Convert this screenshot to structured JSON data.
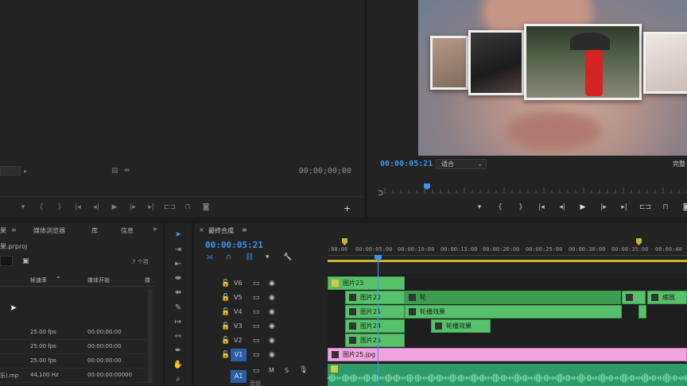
{
  "source_monitor": {
    "timecode": "00;00;00;00"
  },
  "program_monitor": {
    "timecode": "00:00:05:21",
    "fit": "适合",
    "right_label": "完整"
  },
  "project_panel": {
    "tabs": [
      "果",
      "媒体浏览器",
      "库",
      "信息"
    ],
    "project_file": "果.prproj",
    "item_count": "7 个项",
    "columns": [
      "帧速率",
      "媒体开始",
      "媒"
    ],
    "rows": [
      {
        "name": "",
        "fps": "25.00 fps",
        "start": "00:00:00:00"
      },
      {
        "name": "",
        "fps": "25.00 fps",
        "start": "00:00:00:00"
      },
      {
        "name": "",
        "fps": "25.00 fps",
        "start": "00:00:00:00"
      },
      {
        "name": "",
        "fps": "25.00 fps",
        "start": "00:00:00:00"
      },
      {
        "name": "乐).mp",
        "fps": "44,100 Hz",
        "start": "00:00:00:00000"
      }
    ]
  },
  "timeline": {
    "sequence_name": "最终合成",
    "timecode": "00:00:05:21",
    "ruler_labels": [
      ":00:00",
      "00:00:05:00",
      "00:00:10:00",
      "00:00:15:00",
      "00:00:20:00",
      "00:00:25:00",
      "00:00:30:00",
      "00:00:35:00",
      "00:00:40"
    ],
    "tracks": [
      {
        "label": "V6"
      },
      {
        "label": "V5"
      },
      {
        "label": "V4"
      },
      {
        "label": "V3"
      },
      {
        "label": "V2"
      },
      {
        "label": "V1"
      },
      {
        "label": "A1"
      }
    ],
    "track_letters": {
      "m": "M",
      "s": "S"
    },
    "audio_sublabel": "音频",
    "clips": {
      "v6": "图片23",
      "v5a": "图片22",
      "v5b": "轮",
      "v5c": "缩放",
      "v4a": "图片21",
      "v4b": "轮播效果",
      "v3a": "图片24",
      "v3b": "轮播效果",
      "v2": "图片25",
      "v1": "图片25.jpg"
    }
  },
  "colors": {
    "accent_blue": "#3c97ec",
    "clip_green": "#56c16a",
    "clip_pink": "#f0a3e0"
  }
}
